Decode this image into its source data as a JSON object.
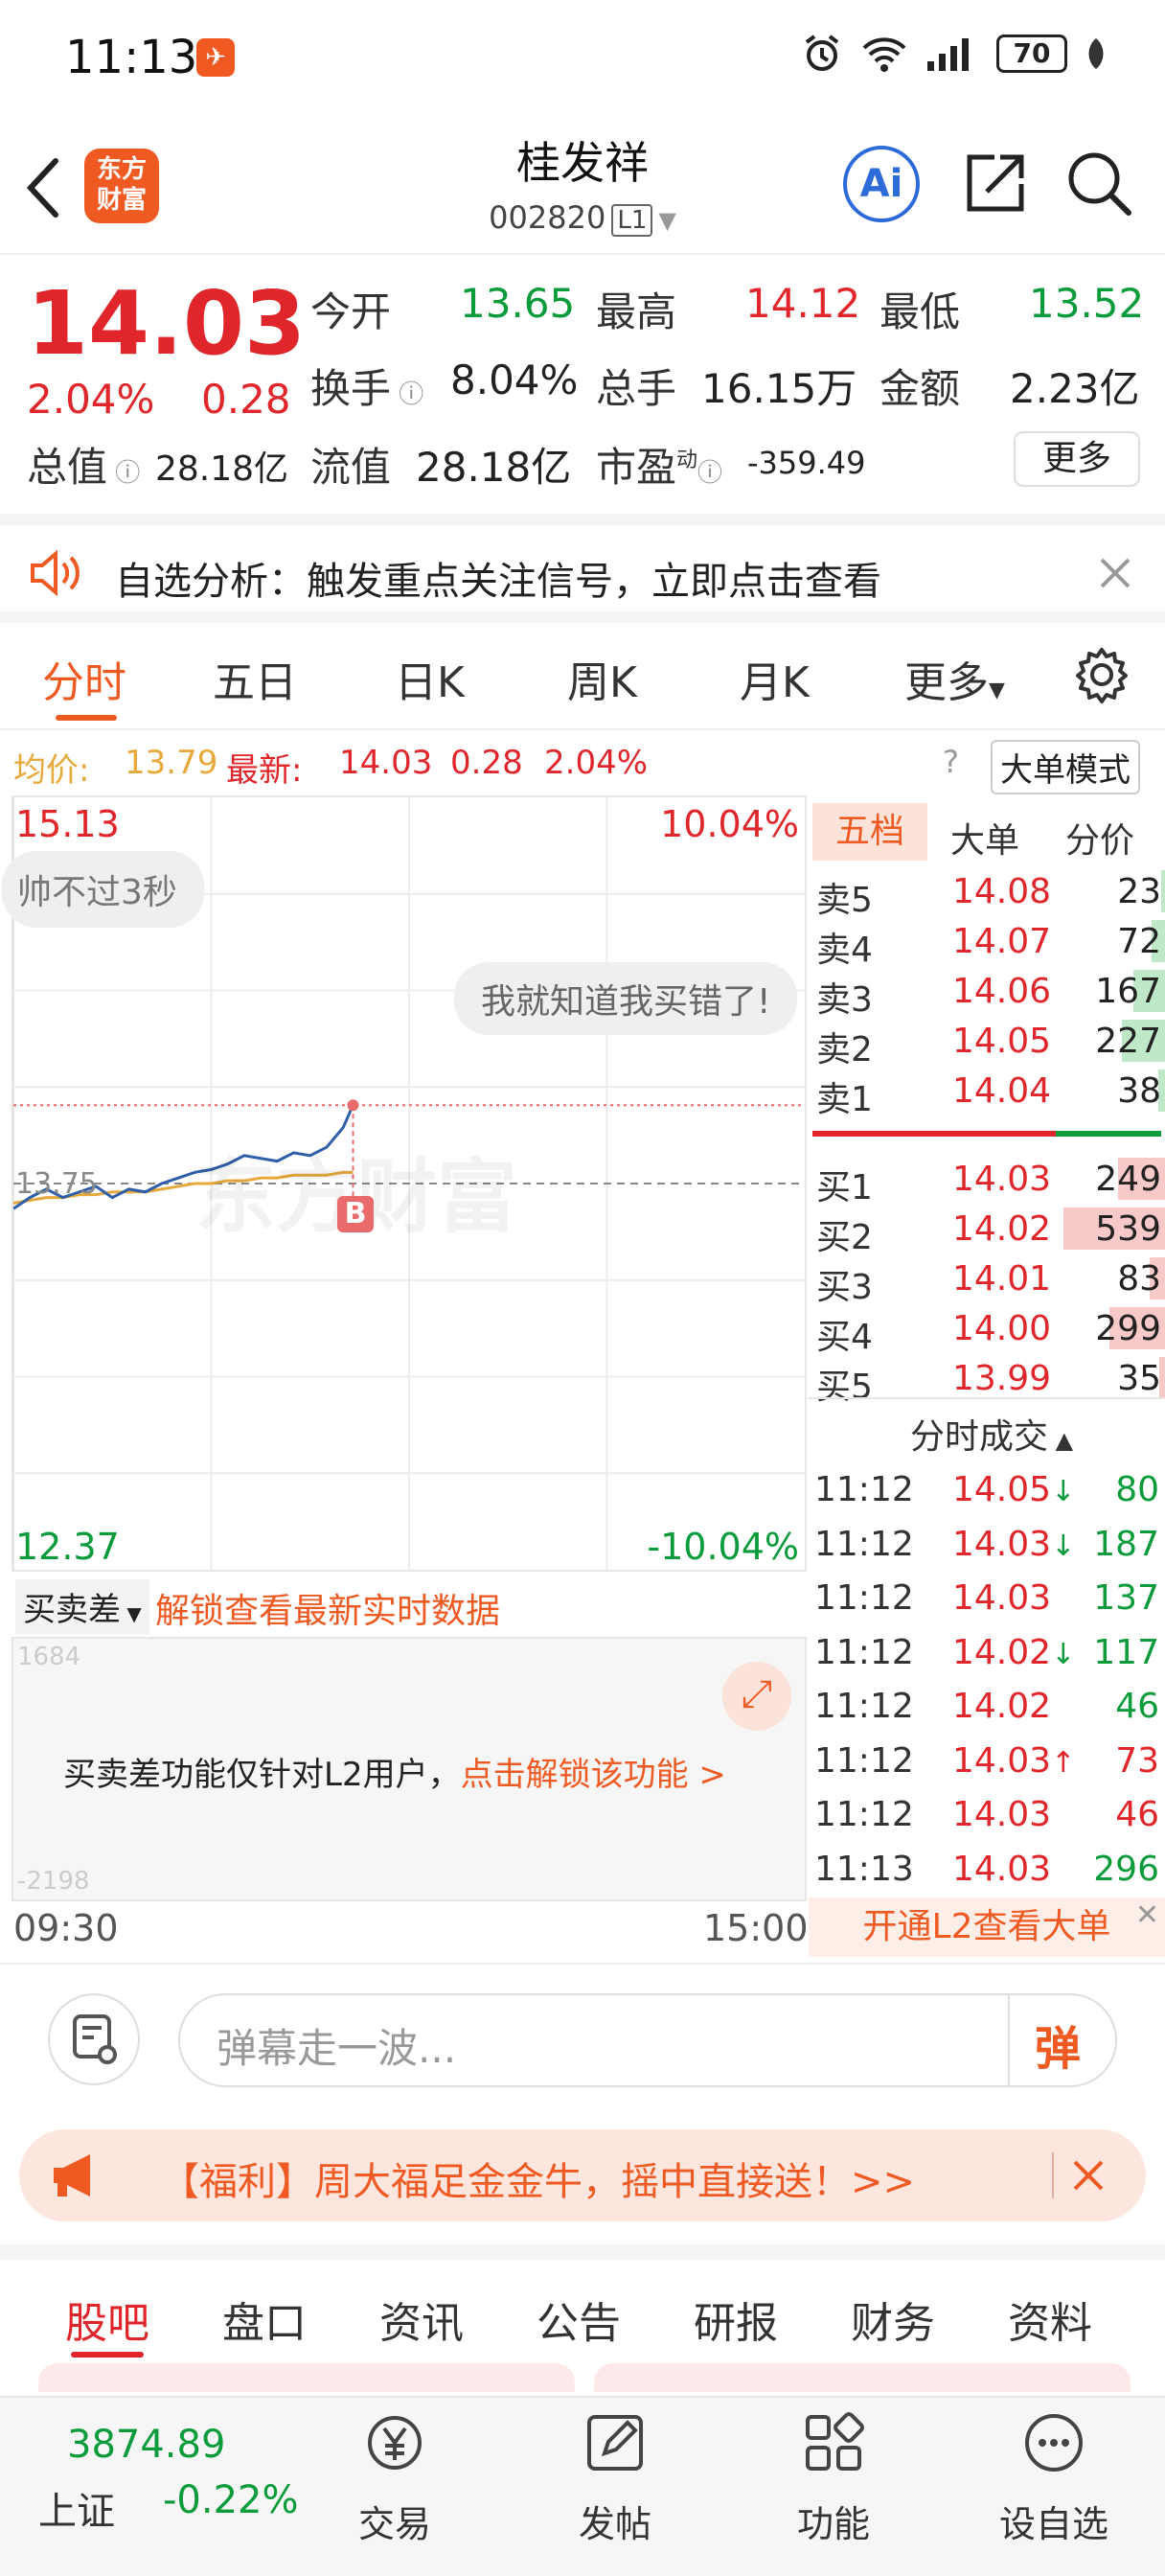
{
  "status_bar": {
    "time": "11:13",
    "battery": "70"
  },
  "header": {
    "logo_text": "东方财富",
    "stock_name": "桂发祥",
    "stock_code": "002820",
    "level_badge": "L1",
    "ai_label": "Ai"
  },
  "quote": {
    "price": "14.03",
    "change_pct": "2.04%",
    "change": "0.28",
    "fields": [
      {
        "label": "今开",
        "value": "13.65"
      },
      {
        "label": "最高",
        "value": "14.12"
      },
      {
        "label": "最低",
        "value": "13.52"
      },
      {
        "label": "换手",
        "value": "8.04%"
      },
      {
        "label": "总手",
        "value": "16.15万"
      },
      {
        "label": "金额",
        "value": "2.23亿"
      },
      {
        "label": "总值",
        "value": "28.18亿"
      },
      {
        "label": "流值",
        "value": "28.18亿"
      },
      {
        "label": "市盈",
        "value": "-359.49",
        "superscript": "动"
      }
    ],
    "more_label": "更多"
  },
  "notice": {
    "text": "自选分析：触发重点关注信号，立即点击查看"
  },
  "period_tabs": [
    "分时",
    "五日",
    "日K",
    "周K",
    "月K",
    "更多"
  ],
  "avg_bar": {
    "avg_label": "均价:",
    "avg_value": "13.79",
    "latest_label": "最新:",
    "latest_price": "14.03",
    "latest_change": "0.28",
    "latest_pct": "2.04%",
    "mode_label": "大单模式"
  },
  "chart": {
    "top_price": "15.13",
    "top_pct": "10.04%",
    "bottom_price": "12.37",
    "bottom_pct": "-10.04%",
    "mid_price": "13.75",
    "watermark": "东方财富",
    "bubble1": "帅不过3秒",
    "bubble2": "我就知道我买错了!",
    "buy_marker": "B",
    "time_start": "09:30",
    "time_end": "15:00",
    "sub_select": "买卖差",
    "sub_unlock": "解锁查看最新实时数据",
    "sub_notice": "买卖差功能仅针对L2用户，",
    "sub_notice_link": "点击解锁该功能 >",
    "sub_top": "1684",
    "sub_bottom": "-2198"
  },
  "chart_data": {
    "type": "line",
    "x": [
      "09:30",
      "09:35",
      "09:40",
      "09:45",
      "09:50",
      "09:55",
      "10:00",
      "10:05",
      "10:10",
      "10:15",
      "10:20",
      "10:25",
      "10:30",
      "10:35",
      "10:40",
      "10:45",
      "10:50",
      "10:55",
      "11:00",
      "11:05",
      "11:10",
      "11:13"
    ],
    "series": [
      {
        "values": [
          13.66,
          13.7,
          13.73,
          13.7,
          13.72,
          13.74,
          13.7,
          13.73,
          13.72,
          13.75,
          13.77,
          13.79,
          13.8,
          13.82,
          13.85,
          13.84,
          13.83,
          13.86,
          13.85,
          13.88,
          13.95,
          14.03
        ]
      },
      {
        "values": [
          13.68,
          13.69,
          13.7,
          13.7,
          13.71,
          13.71,
          13.72,
          13.72,
          13.72,
          13.73,
          13.74,
          13.75,
          13.75,
          13.76,
          13.76,
          13.77,
          13.77,
          13.78,
          13.78,
          13.78,
          13.79,
          13.79
        ]
      }
    ],
    "ylim": [
      12.37,
      15.13
    ],
    "prev_close": 13.75
  },
  "orderbook": {
    "tabs": [
      "五档",
      "大单",
      "分价"
    ],
    "asks": [
      {
        "label": "卖5",
        "price": "14.08",
        "vol": "23",
        "ratio": 0.04
      },
      {
        "label": "卖4",
        "price": "14.07",
        "vol": "72",
        "ratio": 0.13
      },
      {
        "label": "卖3",
        "price": "14.06",
        "vol": "167",
        "ratio": 0.31
      },
      {
        "label": "卖2",
        "price": "14.05",
        "vol": "227",
        "ratio": 0.42
      },
      {
        "label": "卖1",
        "price": "14.04",
        "vol": "38",
        "ratio": 0.07
      }
    ],
    "bids": [
      {
        "label": "买1",
        "price": "14.03",
        "vol": "249",
        "ratio": 0.46
      },
      {
        "label": "买2",
        "price": "14.02",
        "vol": "539",
        "ratio": 1.0
      },
      {
        "label": "买3",
        "price": "14.01",
        "vol": "83",
        "ratio": 0.15
      },
      {
        "label": "买4",
        "price": "14.00",
        "vol": "299",
        "ratio": 0.55
      },
      {
        "label": "买5",
        "price": "13.99",
        "vol": "35",
        "ratio": 0.06
      }
    ],
    "trades_title": "分时成交",
    "trades": [
      {
        "time": "11:12",
        "price": "14.05",
        "arrow": "↓",
        "vol": "80",
        "pcolor": "red",
        "vcolor": "green"
      },
      {
        "time": "11:12",
        "price": "14.03",
        "arrow": "↓",
        "vol": "187",
        "pcolor": "red",
        "vcolor": "green"
      },
      {
        "time": "11:12",
        "price": "14.03",
        "arrow": "",
        "vol": "137",
        "pcolor": "red",
        "vcolor": "green"
      },
      {
        "time": "11:12",
        "price": "14.02",
        "arrow": "↓",
        "vol": "117",
        "pcolor": "red",
        "vcolor": "green"
      },
      {
        "time": "11:12",
        "price": "14.02",
        "arrow": "",
        "vol": "46",
        "pcolor": "red",
        "vcolor": "green"
      },
      {
        "time": "11:12",
        "price": "14.03",
        "arrow": "↑",
        "vol": "73",
        "pcolor": "red",
        "vcolor": "red"
      },
      {
        "time": "11:12",
        "price": "14.03",
        "arrow": "",
        "vol": "46",
        "pcolor": "red",
        "vcolor": "red"
      },
      {
        "time": "11:13",
        "price": "14.03",
        "arrow": "",
        "vol": "296",
        "pcolor": "red",
        "vcolor": "green"
      }
    ],
    "l2_label": "开通L2查看大单"
  },
  "danmaku": {
    "placeholder": "弹幕走一波...",
    "send_label": "弹"
  },
  "promo": {
    "text": "【福利】周大福足金金牛，摇中直接送！>>"
  },
  "bottom_tabs": [
    "股吧",
    "盘口",
    "资讯",
    "公告",
    "研报",
    "财务",
    "资料"
  ],
  "navbar": {
    "index_value": "3874.89",
    "index_name": "上证",
    "index_change": "-0.22%",
    "items": [
      "交易",
      "发帖",
      "功能",
      "设自选"
    ]
  },
  "colors": {
    "up": "#e0262b",
    "down": "#0a9b3a",
    "accent": "#ef5a23",
    "line": "#2f5fa8",
    "avg": "#e8a93c"
  }
}
